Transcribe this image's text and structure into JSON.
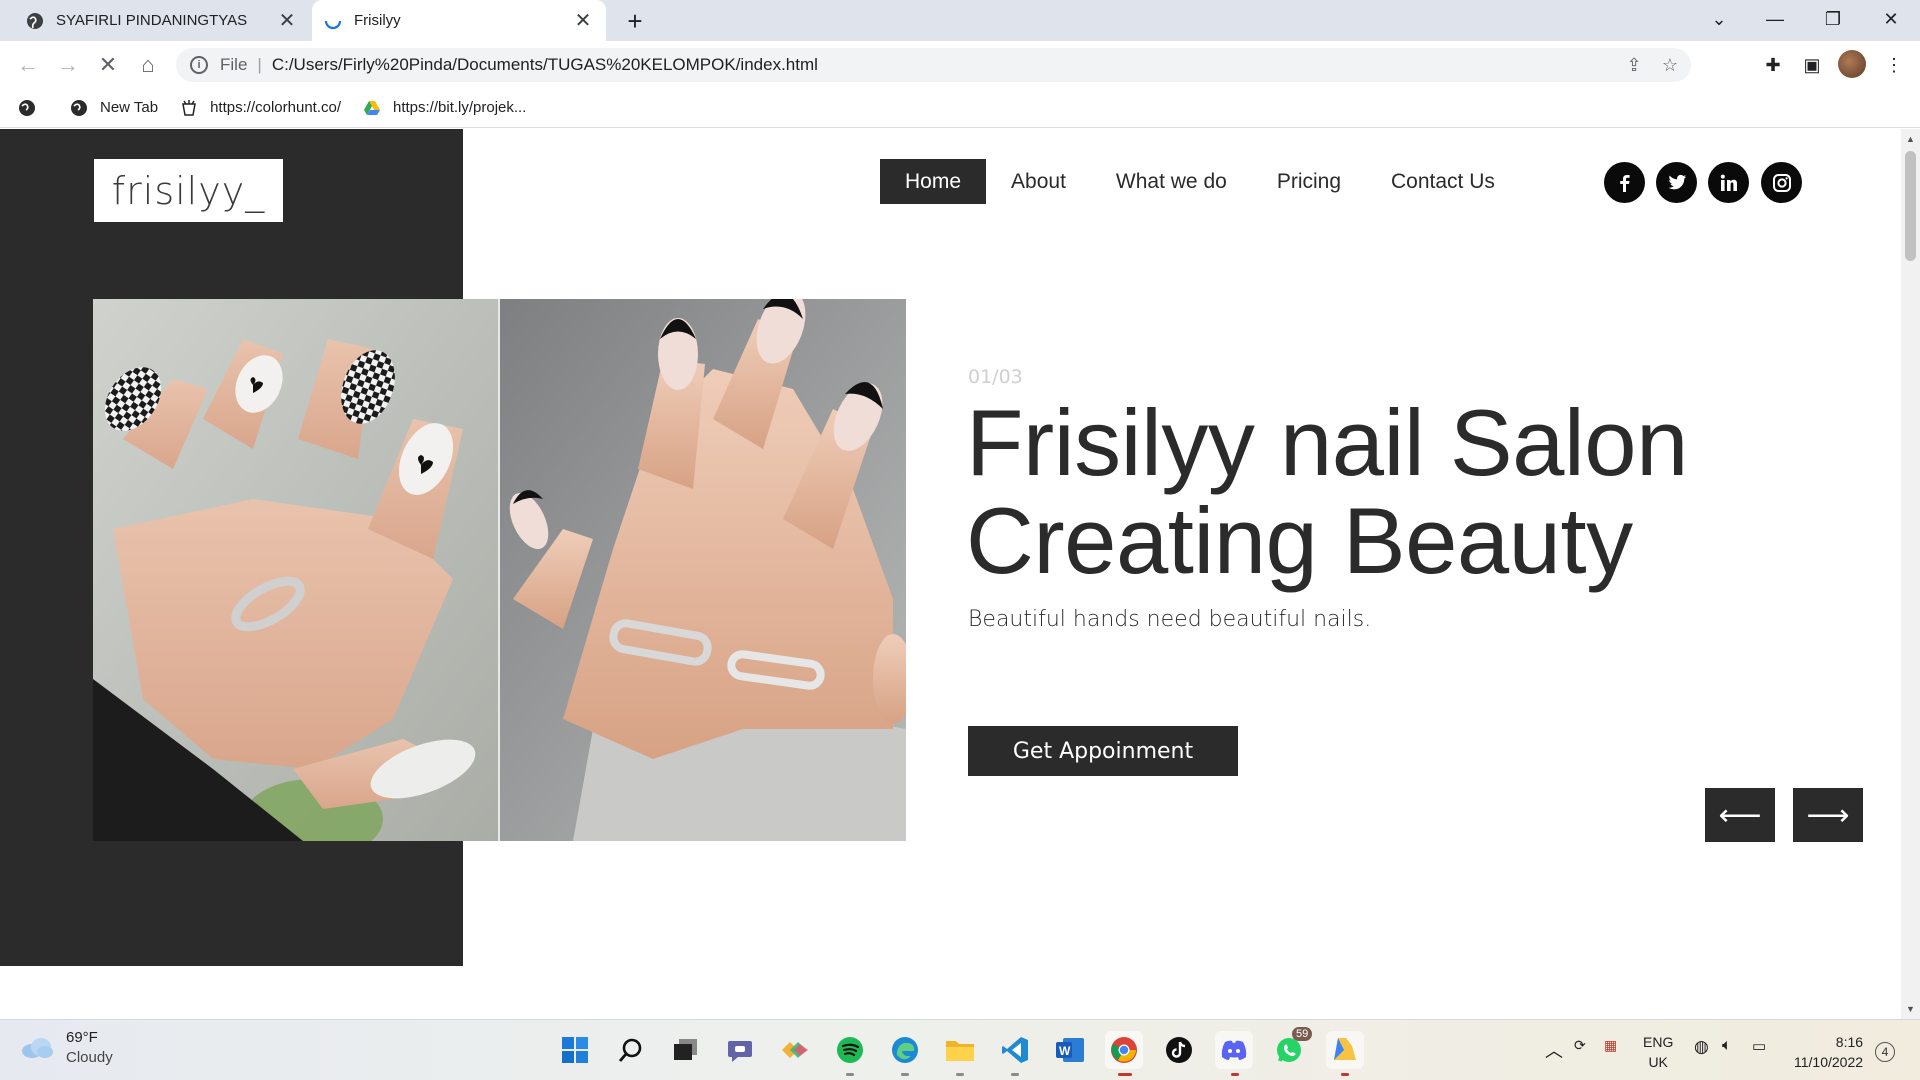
{
  "browser": {
    "tabs": [
      {
        "title": "SYAFIRLI PINDANINGTYAS",
        "active": false
      },
      {
        "title": "Frisilyy",
        "active": true
      }
    ],
    "address": {
      "scheme": "File",
      "url": "C:/Users/Firly%20Pinda/Documents/TUGAS%20KELOMPOK/index.html"
    },
    "bookmarks": [
      {
        "label": "New Tab"
      },
      {
        "label": "https://colorhunt.co/"
      },
      {
        "label": "https://bit.ly/projek..."
      }
    ]
  },
  "page": {
    "logo": "frisilyy_",
    "nav": [
      {
        "label": "Home",
        "active": true
      },
      {
        "label": "About",
        "active": false
      },
      {
        "label": "What we do",
        "active": false
      },
      {
        "label": "Pricing",
        "active": false
      },
      {
        "label": "Contact Us",
        "active": false
      }
    ],
    "social": [
      "facebook-icon",
      "twitter-icon",
      "linkedin-icon",
      "instagram-icon"
    ],
    "hero": {
      "counter": "01/03",
      "headline_line1": "Frisilyy nail Salon",
      "headline_line2": "Creating Beauty",
      "subline": "Beautiful hands need beautiful nails.",
      "cta": "Get Appoinment",
      "prev": "⟵",
      "next": "⟶"
    },
    "colors": {
      "dark": "#2b2b2b",
      "white": "#ffffff"
    }
  },
  "taskbar": {
    "weather": {
      "temp": "69°F",
      "condition": "Cloudy"
    },
    "whatsapp_badge": "59",
    "lang": {
      "line1": "ENG",
      "line2": "UK"
    },
    "clock": {
      "time": "8:16",
      "date": "11/10/2022"
    },
    "notifications": "4"
  }
}
